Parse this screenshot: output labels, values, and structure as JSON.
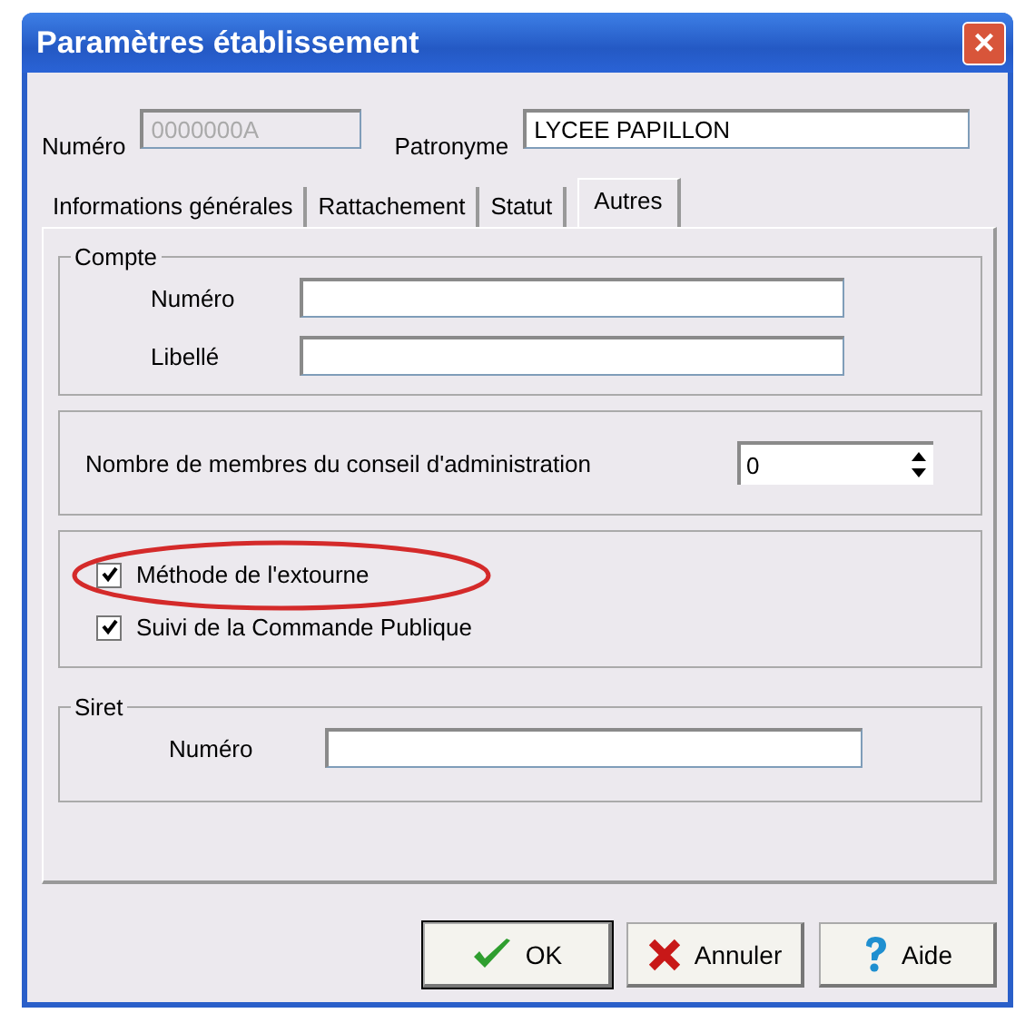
{
  "window": {
    "title": "Paramètres établissement",
    "close": "×"
  },
  "header": {
    "numero": {
      "label": "Numéro",
      "value": "0000000A",
      "disabled": true
    },
    "patronyme": {
      "label": "Patronyme",
      "value": "LYCEE PAPILLON",
      "disabled": false
    }
  },
  "tabs": [
    {
      "label": "Informations générales",
      "selected": false
    },
    {
      "label": "Rattachement",
      "selected": false
    },
    {
      "label": "Statut",
      "selected": false
    },
    {
      "label": "Autres",
      "selected": true
    }
  ],
  "compte": {
    "title": "Compte",
    "fields": [
      {
        "label": "Numéro"
      },
      {
        "label": "Libellé"
      }
    ]
  },
  "conseil": {
    "label": "Nombre de membres du conseil d'administration",
    "value": "0"
  },
  "options": [
    {
      "label": "Méthode de l'extourne",
      "checked": true,
      "highlighted": true
    },
    {
      "label": "Suivi de la Commande Publique",
      "checked": true,
      "highlighted": false
    }
  ],
  "siret": {
    "title": "Siret",
    "fields": [
      {
        "label": "Numéro"
      }
    ]
  },
  "buttons": [
    {
      "label": "OK",
      "kind": "ok",
      "default": true
    },
    {
      "label": "Annuler",
      "kind": "cancel",
      "default": false
    },
    {
      "label": "Aide",
      "kind": "help",
      "default": false
    }
  ]
}
